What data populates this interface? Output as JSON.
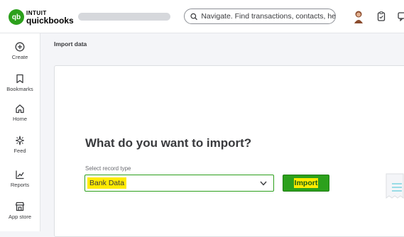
{
  "brand": {
    "intuit": "INTUIT",
    "product": "quickbooks",
    "logo_mark": "qb"
  },
  "search": {
    "placeholder": "Navigate. Find transactions, contacts, hel..."
  },
  "sidebar": {
    "items": [
      {
        "label": "Create",
        "icon": "plus-circle-icon"
      },
      {
        "label": "Bookmarks",
        "icon": "bookmark-icon"
      },
      {
        "label": "Home",
        "icon": "home-icon"
      },
      {
        "label": "Feed",
        "icon": "sparkle-icon"
      },
      {
        "label": "Reports",
        "icon": "chart-icon"
      },
      {
        "label": "App store",
        "icon": "store-icon"
      }
    ]
  },
  "page": {
    "title": "Import data"
  },
  "import": {
    "heading": "What do you want to import?",
    "select_label": "Select record type",
    "selected_value": "Bank Data",
    "button_label": "Import"
  },
  "colors": {
    "brand_green": "#2ca01c",
    "highlight": "#ffeb00",
    "text": "#393a3d"
  }
}
